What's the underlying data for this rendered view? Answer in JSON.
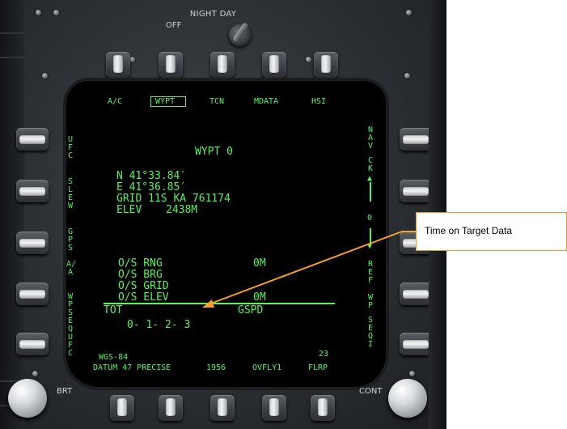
{
  "panel": {
    "night_day_label": "NIGHT    DAY",
    "off_label": "OFF"
  },
  "pushbutton_labels": {
    "top": [
      "A/C",
      "WYPT",
      "TCN",
      "MDATA",
      "HSI"
    ],
    "left": [
      "UFC",
      "SLEW",
      "GPS",
      "A/A",
      "WPSEQUFC"
    ],
    "right": [
      "NAV",
      "CK",
      "REF",
      "WP",
      "SEQI"
    ],
    "bottom": [
      "DATUM 47 PRECISE",
      "1956",
      "OVFLY1",
      "FLRP"
    ]
  },
  "display": {
    "title": "WYPT 0",
    "lat": "N 41°33.84′",
    "lon": "E 41°36.85′",
    "grid": "GRID 11S KA 761174",
    "elev_label": "ELEV",
    "elev_value": "2438M",
    "right_arrow_value": "0",
    "os_rng": "O/S RNG",
    "os_rng_value": "0M",
    "os_brg": "O/S BRG",
    "os_grid": "O/S GRID",
    "os_elev": "O/S ELEV",
    "os_elev_value": "0M",
    "tot_label": "TOT",
    "gspd_label": "GSPD",
    "tot_value": "0- 1- 2- 3",
    "datum_label": "WGS-84",
    "flrp_number": "23"
  },
  "knobs": {
    "brt_label": "BRT",
    "cont_label": "CONT"
  },
  "callout": {
    "text": "Time on Target Data",
    "color": "#f7a030"
  },
  "colors": {
    "symbology": "#57f45c",
    "bezel": "#2f3337"
  }
}
